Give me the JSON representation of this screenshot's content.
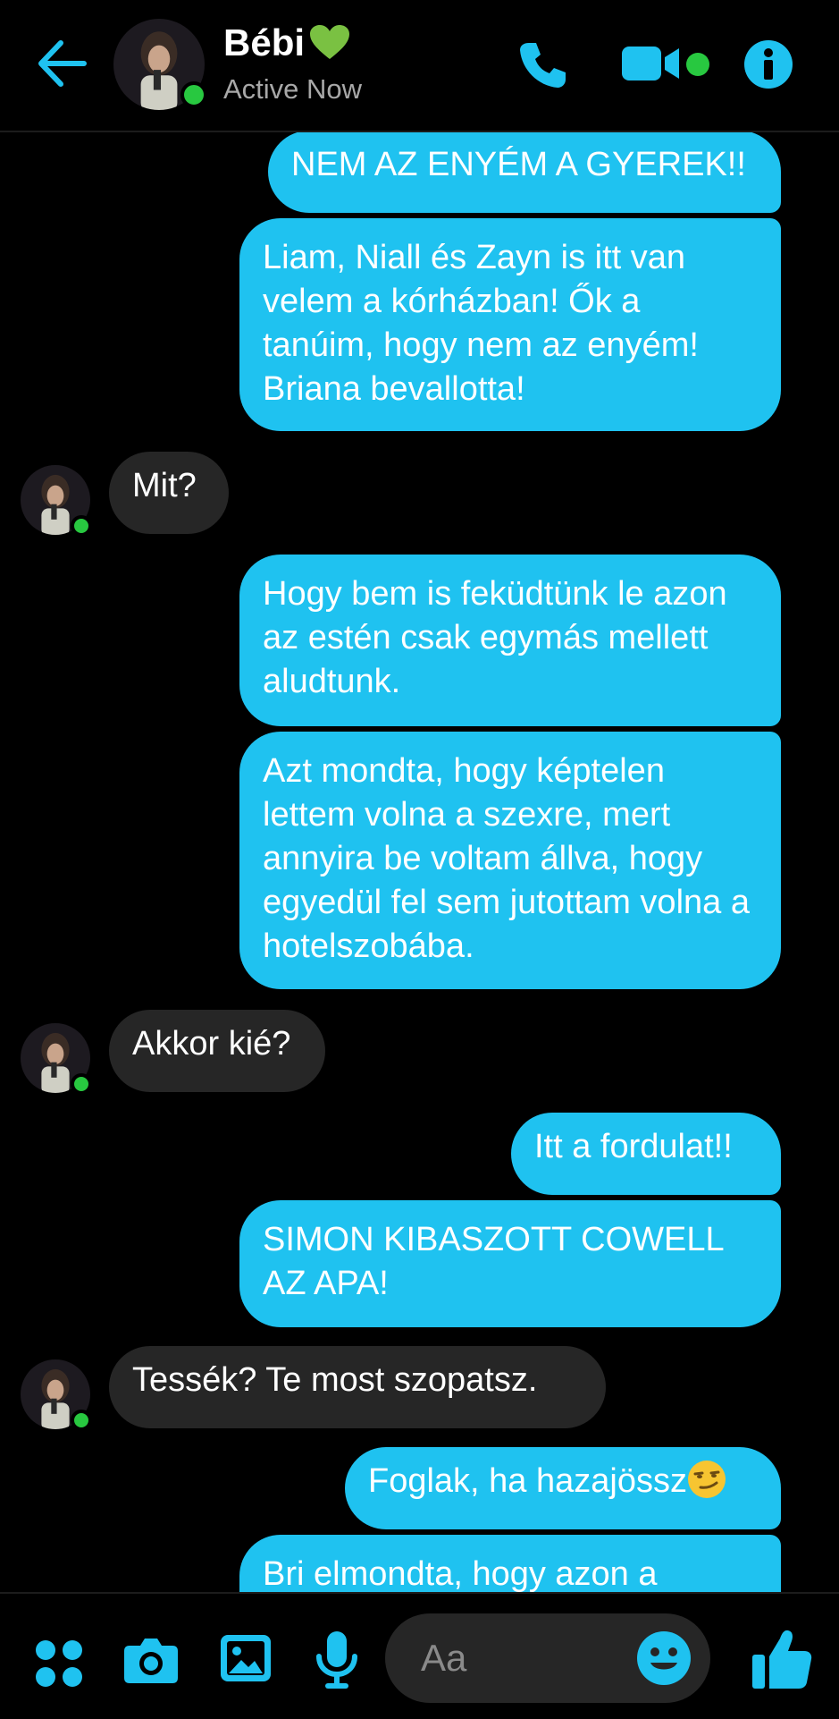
{
  "header": {
    "name": "Bébi",
    "status": "Active Now",
    "icons": [
      "back-arrow-icon",
      "phone-icon",
      "video-call-icon",
      "info-icon"
    ]
  },
  "messages": [
    {
      "id": 0,
      "dir": "sent",
      "text": "NEM AZ ENYÉM A GYEREK!!"
    },
    {
      "id": 1,
      "dir": "sent",
      "text": "Liam, Niall és Zayn is itt van velem a kórházban! Ők a tanúim, hogy nem az enyém! Briana bevallotta!"
    },
    {
      "id": 2,
      "dir": "recv",
      "text": "Mit?"
    },
    {
      "id": 3,
      "dir": "sent",
      "text": "Hogy bem is feküdtünk le azon az estén csak egymás mellett aludtunk."
    },
    {
      "id": 4,
      "dir": "sent",
      "text": "Azt mondta, hogy képtelen lettem volna a szexre, mert annyira be voltam állva, hogy egyedül fel sem jutottam volna a hotelszobába."
    },
    {
      "id": 5,
      "dir": "recv",
      "text": "Akkor kié?"
    },
    {
      "id": 6,
      "dir": "sent",
      "text": "Itt a fordulat!!"
    },
    {
      "id": 7,
      "dir": "sent",
      "text": "SIMON KIBASZOTT COWELL AZ APA!"
    },
    {
      "id": 8,
      "dir": "recv",
      "text": "Tessék? Te most szopatsz."
    },
    {
      "id": 9,
      "dir": "sent",
      "text": "Foglak, ha hazajössz"
    },
    {
      "id": 10,
      "dir": "sent",
      "text": "Bri elmondta, hogy azon a"
    }
  ],
  "composer": {
    "placeholder": "Aa",
    "icons": [
      "apps-icon",
      "camera-icon",
      "gallery-icon",
      "microphone-icon",
      "emoji-icon",
      "thumbs-up-icon"
    ]
  },
  "colors": {
    "accent": "#1fc2f0",
    "received_bubble": "#262626",
    "online": "#28c840",
    "background": "#000000"
  }
}
